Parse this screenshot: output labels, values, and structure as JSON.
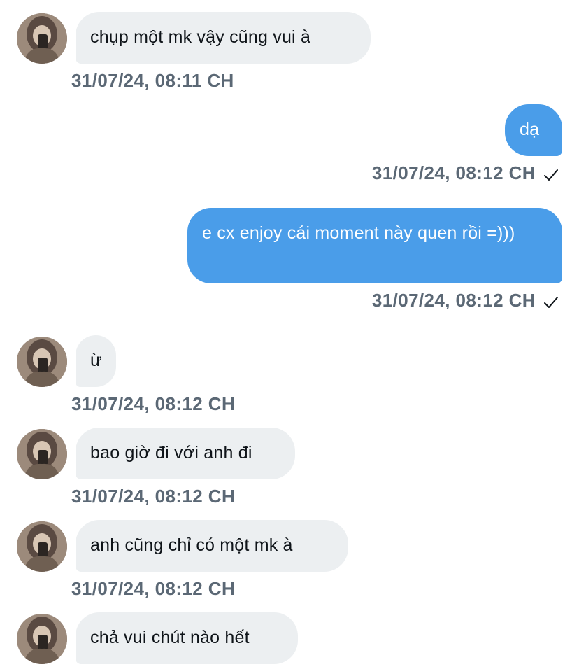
{
  "messages": [
    {
      "direction": "in",
      "text": "chụp một mk vậy cũng vui à",
      "time": "31/07/24, 08:11 CH"
    },
    {
      "direction": "out",
      "text": "dạ",
      "time": "31/07/24, 08:12 CH",
      "status_icon": "check-icon"
    },
    {
      "direction": "out",
      "text": "e cx enjoy cái moment này quen rồi =)))",
      "time": "31/07/24, 08:12 CH",
      "status_icon": "check-icon"
    },
    {
      "direction": "in",
      "text": "ừ",
      "time": "31/07/24, 08:12 CH"
    },
    {
      "direction": "in",
      "text": "bao giờ đi với anh đi",
      "time": "31/07/24, 08:12 CH"
    },
    {
      "direction": "in",
      "text": "anh cũng chỉ có một mk à",
      "time": "31/07/24, 08:12 CH"
    },
    {
      "direction": "in",
      "text": "chả vui chút nào hết"
    }
  ],
  "colors": {
    "incoming_bubble": "#eceff1",
    "outgoing_bubble": "#4a9de9",
    "timestamp": "#5b6875",
    "incoming_text": "#0f1419",
    "outgoing_text": "#ffffff"
  }
}
